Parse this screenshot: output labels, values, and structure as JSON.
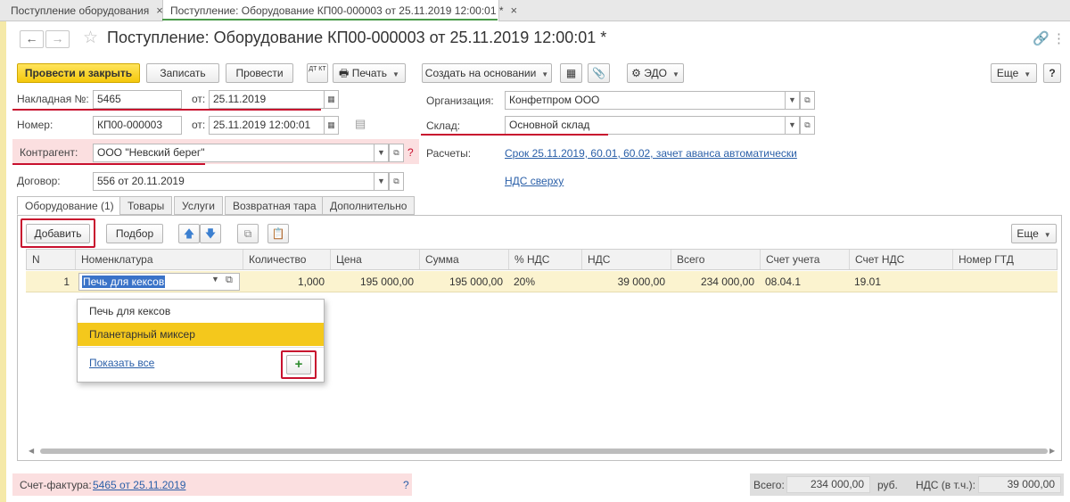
{
  "tabs": [
    {
      "label": "Поступление оборудования",
      "close": "×"
    },
    {
      "label": "Поступление: Оборудование КП00-000003 от 25.11.2019 12:00:01 *",
      "close": "×"
    }
  ],
  "header": {
    "title": "Поступление: Оборудование КП00-000003 от 25.11.2019 12:00:01 *",
    "back_icon": "arrow-left-icon",
    "forward_icon": "arrow-right-icon",
    "star_icon": "star-icon"
  },
  "toolbar": {
    "post_close": "Провести и закрыть",
    "save": "Записать",
    "post": "Провести",
    "dtkt": "ДТ КТ",
    "print": "Печать",
    "create_based": "Создать на основании",
    "edo": "ЭДО",
    "more": "Еще"
  },
  "form": {
    "invoice_label": "Накладная  №:",
    "invoice_value": "5465",
    "from_label": "от:",
    "invoice_date": "25.11.2019",
    "number_label": "Номер:",
    "number_value": "КП00-000003",
    "number_date": "25.11.2019 12:00:01",
    "contractor_label": "Контрагент:",
    "contractor_value": "ООО \"Невский берег\"",
    "contract_label": "Договор:",
    "contract_value": "556 от 20.11.2019",
    "org_label": "Организация:",
    "org_value": "Конфетпром ООО",
    "warehouse_label": "Склад:",
    "warehouse_value": "Основной склад",
    "settlements_label": "Расчеты:",
    "settlements_link": "Срок 25.11.2019, 60.01, 60.02, зачет аванса автоматически",
    "vat_link": "НДС сверху",
    "qmark": "?"
  },
  "inner_tabs": [
    "Оборудование (1)",
    "Товары",
    "Услуги",
    "Возвратная тара",
    "Дополнительно"
  ],
  "table_toolbar": {
    "add": "Добавить",
    "select": "Подбор",
    "more": "Еще"
  },
  "table": {
    "columns": [
      "N",
      "Номенклатура",
      "Количество",
      "Цена",
      "Сумма",
      "% НДС",
      "НДС",
      "Всего",
      "Счет учета",
      "Счет НДС",
      "Номер ГТД"
    ],
    "row": {
      "n": "1",
      "item": "Печь для кексов",
      "qty": "1,000",
      "price": "195 000,00",
      "sum": "195 000,00",
      "vat_rate": "20%",
      "vat": "39 000,00",
      "total": "234 000,00",
      "account": "08.04.1",
      "vat_account": "19.01",
      "gtd": ""
    }
  },
  "dropdown": {
    "items": [
      "Печь для кексов",
      "Планетарный миксер"
    ],
    "show_all": "Показать все",
    "add": "+"
  },
  "footer": {
    "invoice_label": "Счет-фактура:",
    "invoice_link": "5465 от 25.11.2019",
    "qmark": "?",
    "total_label": "Всего:",
    "total_value": "234 000,00",
    "currency": "руб.",
    "vat_label": "НДС (в т.ч.):",
    "vat_value": "39 000,00"
  }
}
